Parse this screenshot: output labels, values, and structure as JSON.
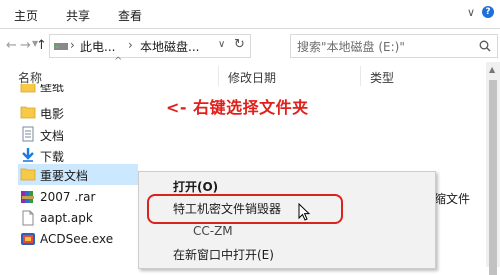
{
  "ribbon": {
    "tabs": [
      "主页",
      "共享",
      "查看"
    ]
  },
  "nav": {
    "address_parts": [
      "此电...",
      "本地磁盘..."
    ],
    "search_placeholder": "搜索\"本地磁盘 (E:)\""
  },
  "columns": {
    "name": "名称",
    "modified": "修改日期",
    "type": "类型"
  },
  "files": [
    {
      "name": "壁纸",
      "icon": "folder-icon"
    },
    {
      "name": "电影",
      "icon": "folder-icon"
    },
    {
      "name": "文档",
      "icon": "document-folder-icon"
    },
    {
      "name": "下载",
      "icon": "download-folder-icon"
    },
    {
      "name": "重要文档",
      "icon": "folder-icon",
      "selected": true
    },
    {
      "name": "2007 .rar",
      "icon": "rar-icon",
      "type": "压缩文件"
    },
    {
      "name": "aapt.apk",
      "icon": "apk-file-icon"
    },
    {
      "name": "ACDSee.exe",
      "icon": "exe-icon"
    }
  ],
  "annotation": "<- 右键选择文件夹",
  "context_menu": {
    "items": [
      "打开(O)",
      "特工机密文件销毁器",
      "CC-ZM",
      "在新窗口中打开(E)"
    ]
  },
  "colors": {
    "highlight_border": "#d9231c",
    "annotation": "#e0201b",
    "selection": "#cce8ff"
  }
}
